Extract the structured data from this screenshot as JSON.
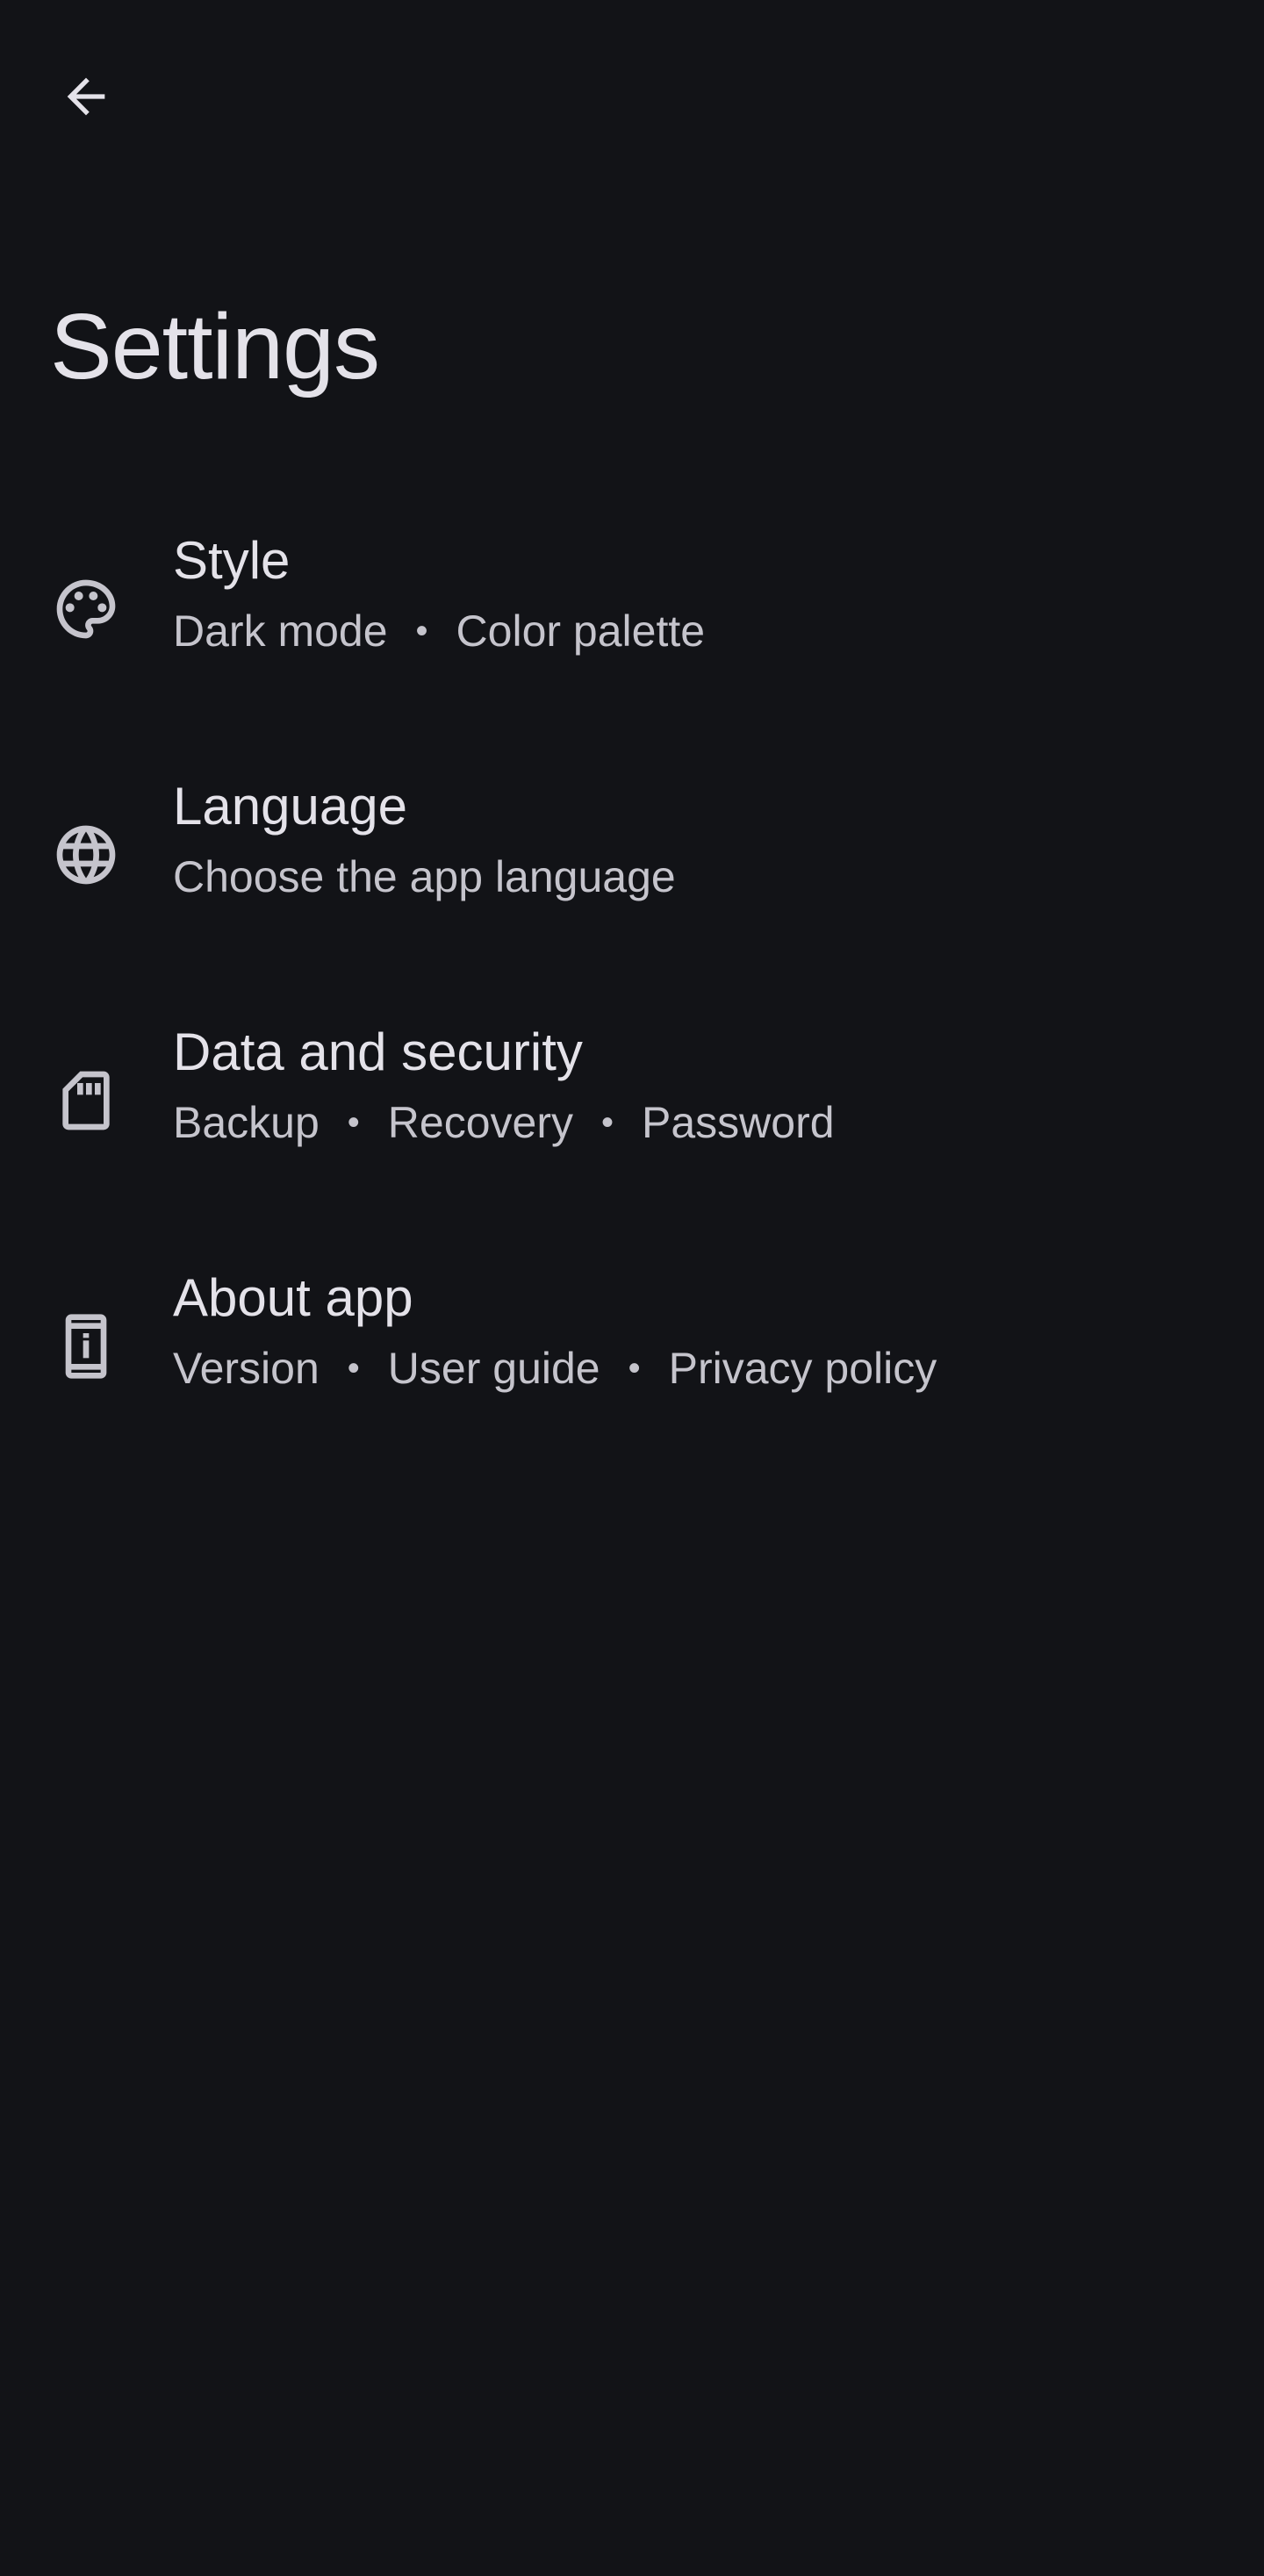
{
  "header": {
    "back_icon": "arrow-back-icon",
    "title": "Settings"
  },
  "items": [
    {
      "icon": "palette-icon",
      "title": "Style",
      "subtitle_parts": [
        "Dark mode",
        "Color palette"
      ],
      "separator": "•"
    },
    {
      "icon": "globe-icon",
      "title": "Language",
      "subtitle_parts": [
        "Choose the app language"
      ],
      "separator": "•"
    },
    {
      "icon": "sd-card-icon",
      "title": "Data and security",
      "subtitle_parts": [
        "Backup",
        "Recovery",
        "Password"
      ],
      "separator": "•"
    },
    {
      "icon": "device-info-icon",
      "title": "About app",
      "subtitle_parts": [
        "Version",
        "User guide",
        "Privacy policy"
      ],
      "separator": "•"
    }
  ],
  "colors": {
    "background": "#121317",
    "title_text": "#e4e2e9",
    "subtitle_text": "#c5c4cc",
    "icon": "#c5c4cc"
  }
}
